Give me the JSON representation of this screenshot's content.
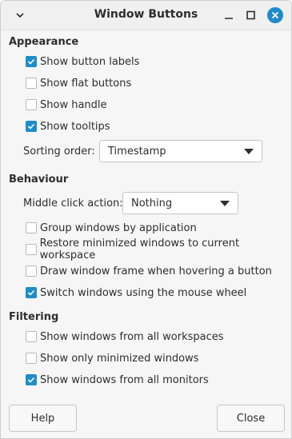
{
  "window": {
    "title": "Window Buttons"
  },
  "colors": {
    "accent": "#1f8cc9",
    "background": "#f6f6f6"
  },
  "sections": {
    "appearance": {
      "title": "Appearance",
      "show_button_labels": {
        "label": "Show button labels",
        "checked": true
      },
      "show_flat_buttons": {
        "label": "Show flat buttons",
        "checked": false
      },
      "show_handle": {
        "label": "Show handle",
        "checked": false
      },
      "show_tooltips": {
        "label": "Show tooltips",
        "checked": true
      },
      "sorting_order": {
        "label": "Sorting order:",
        "value": "Timestamp"
      }
    },
    "behaviour": {
      "title": "Behaviour",
      "middle_click": {
        "label": "Middle click action:",
        "value": "Nothing"
      },
      "group_windows": {
        "label": "Group windows by application",
        "checked": false
      },
      "restore_minimized": {
        "label": "Restore minimized windows to current workspace",
        "checked": false
      },
      "draw_frame": {
        "label": "Draw window frame when hovering a button",
        "checked": false
      },
      "switch_wheel": {
        "label": "Switch windows using the mouse wheel",
        "checked": true
      }
    },
    "filtering": {
      "title": "Filtering",
      "all_workspaces": {
        "label": "Show windows from all workspaces",
        "checked": false
      },
      "only_minimized": {
        "label": "Show only minimized windows",
        "checked": false
      },
      "all_monitors": {
        "label": "Show windows from all monitors",
        "checked": true
      }
    }
  },
  "footer": {
    "help_label": "Help",
    "close_label": "Close"
  },
  "icons": {
    "menu": "chevron-down-icon",
    "minimize": "minimize-icon",
    "maximize": "maximize-icon",
    "close": "close-icon"
  }
}
